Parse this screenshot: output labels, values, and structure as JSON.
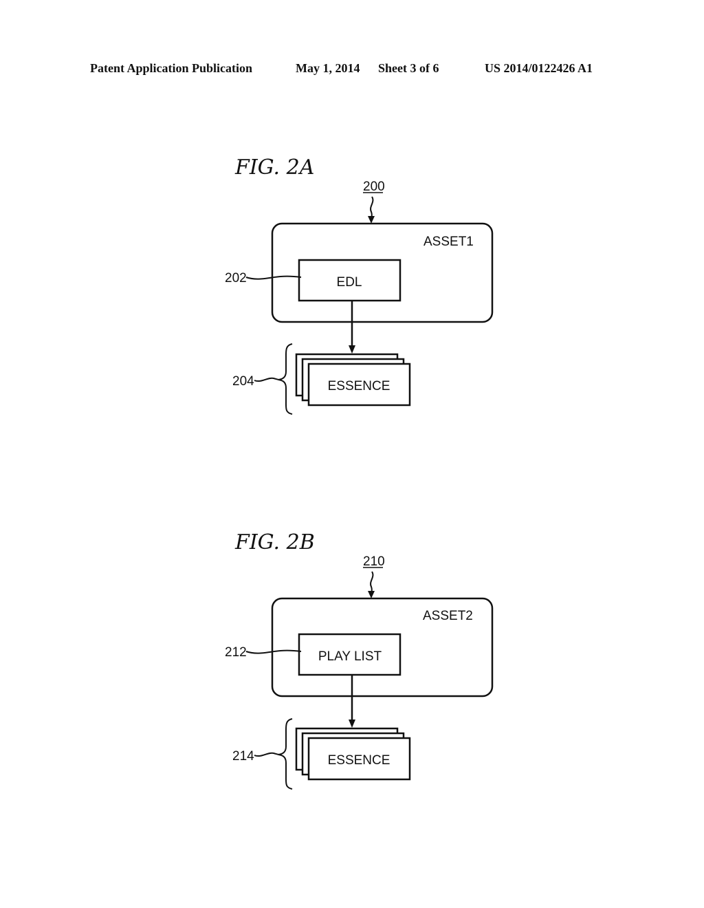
{
  "header": {
    "publication": "Patent Application Publication",
    "date": "May 1, 2014",
    "sheet": "Sheet 3 of 6",
    "number": "US 2014/0122426 A1"
  },
  "figures": [
    {
      "title": "FIG. 2A",
      "ref": "200",
      "asset_label": "ASSET1",
      "inner_label": "EDL",
      "inner_ref": "202",
      "essence_label": "ESSENCE",
      "essence_ref": "204"
    },
    {
      "title": "FIG. 2B",
      "ref": "210",
      "asset_label": "ASSET2",
      "inner_label": "PLAY LIST",
      "inner_ref": "212",
      "essence_label": "ESSENCE",
      "essence_ref": "214"
    }
  ]
}
